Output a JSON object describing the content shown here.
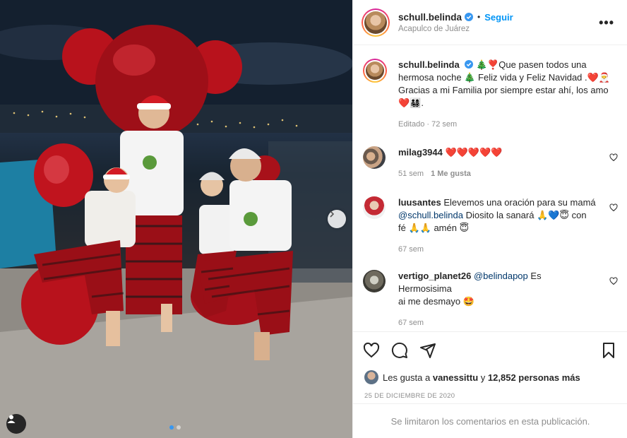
{
  "post": {
    "author": "schull.belinda",
    "follow_label": "Seguir",
    "separator": "•",
    "location": "Acapulco de Juárez",
    "more_label": "•••"
  },
  "caption": {
    "author": "schull.belinda",
    "line1": "🎄❣️Que pasen todos una",
    "line2": "hermosa noche 🎄 Feliz vida y Feliz Navidad .❤️🎅",
    "line3": "Gracias a mi Familia por siempre estar ahí, los amo",
    "line4": "❤️👨‍👩‍👧‍👦.",
    "meta": "Editado · 72 sem"
  },
  "comments": [
    {
      "author": "milag3944",
      "text": "❤️❤️❤️❤️❤️",
      "time": "51 sem",
      "likes": "1 Me gusta"
    },
    {
      "author": "luusantes",
      "text_a": "Elevemos una oración para su mamá",
      "mention": "@schull.belinda",
      "text_b": "Diosito la sanará 🙏💙😇 con",
      "text_c": "fé 🙏🙏 amén 😇",
      "time": "67 sem"
    },
    {
      "author": "vertigo_planet26",
      "mention": "@belindapop",
      "text_a": "Es Hermosisima",
      "text_b": "ai me desmayo 🤩",
      "time": "67 sem"
    }
  ],
  "likes": {
    "prefix": "Les gusta a",
    "user": "vanessittu",
    "middle": "y",
    "count": "12,852 personas más"
  },
  "date": "25 DE DICIEMBRE DE 2020",
  "footer": "Se limitaron los comentarios en esta publicación.",
  "colors": {
    "link": "#0095f6",
    "muted": "#8e8e8e",
    "text": "#262626",
    "pajama_red": "#a3121c"
  },
  "icons": [
    "verified-icon",
    "more-icon",
    "heart-icon",
    "comment-icon",
    "share-icon",
    "bookmark-icon",
    "chevron-right-icon",
    "user-tag-icon"
  ]
}
